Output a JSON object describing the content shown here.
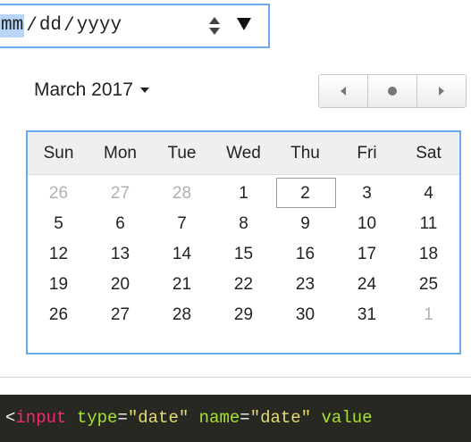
{
  "date_input": {
    "month": "mm",
    "sep1": "/",
    "day": "dd",
    "sep2": "/",
    "year": "yyyy"
  },
  "calendar": {
    "month_label": "March 2017",
    "weekdays": [
      "Sun",
      "Mon",
      "Tue",
      "Wed",
      "Thu",
      "Fri",
      "Sat"
    ],
    "weeks": [
      [
        "26",
        "27",
        "28",
        "1",
        "2",
        "3",
        "4"
      ],
      [
        "5",
        "6",
        "7",
        "8",
        "9",
        "10",
        "11"
      ],
      [
        "12",
        "13",
        "14",
        "15",
        "16",
        "17",
        "18"
      ],
      [
        "19",
        "20",
        "21",
        "22",
        "23",
        "24",
        "25"
      ],
      [
        "26",
        "27",
        "28",
        "29",
        "30",
        "31",
        "1"
      ]
    ],
    "today": "2",
    "colors": {
      "accent": "#6aa9ec",
      "muted_day": "#b0b0b0",
      "header_bg": "#efefef"
    }
  },
  "nav": {
    "prev_icon": "triangle-left-icon",
    "today_icon": "dot-icon",
    "next_icon": "triangle-right-icon"
  },
  "code": {
    "open": "<",
    "tag": "input",
    "attr1": "type",
    "eq1": "=",
    "val1": "\"date\"",
    "attr2": "name",
    "eq2": "=",
    "val2": "\"date\"",
    "attr3": "value",
    "colors": {
      "bg": "#272822",
      "tag": "#f92672",
      "attr": "#a6e22e",
      "string": "#e6db74"
    }
  }
}
